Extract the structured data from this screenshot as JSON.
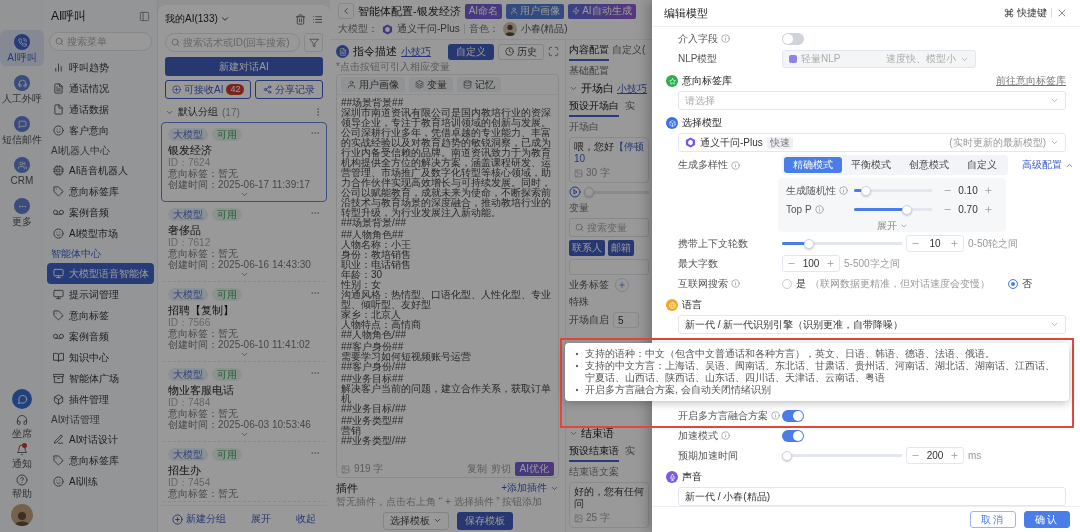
{
  "rail": {
    "items": [
      {
        "label": "AI呼叫",
        "selected": true
      },
      {
        "label": "人工外呼",
        "selected": false
      },
      {
        "label": "短信邮件",
        "selected": false
      },
      {
        "label": "CRM",
        "selected": false
      },
      {
        "label": "更多",
        "selected": false
      }
    ],
    "bottom_items": [
      {
        "label": "坐席",
        "unread": false
      },
      {
        "label": "通知",
        "unread": true
      },
      {
        "label": "帮助",
        "unread": false
      }
    ]
  },
  "menu": {
    "title": "AI呼叫",
    "search": {
      "placeholder": "搜索菜单"
    },
    "sections": [
      {
        "items": [
          {
            "label": "呼叫趋势",
            "selected": false
          },
          {
            "label": "通话情况",
            "selected": false
          },
          {
            "label": "通话数据",
            "selected": false
          },
          {
            "label": "客户意向",
            "selected": false
          }
        ]
      },
      {
        "title": "AI机器人中心",
        "current": false,
        "items": [
          {
            "label": "AI语音机器人",
            "selected": false
          },
          {
            "label": "意向标签库",
            "selected": false
          },
          {
            "label": "案例音频",
            "selected": false
          },
          {
            "label": "AI模型市场",
            "selected": false
          }
        ]
      },
      {
        "title": "智能体中心",
        "current": true,
        "items": [
          {
            "label": "大模型语音智能体",
            "selected": true
          },
          {
            "label": "提示词管理",
            "selected": false
          },
          {
            "label": "意向标签",
            "selected": false
          },
          {
            "label": "案例音频",
            "selected": false
          },
          {
            "label": "知识中心",
            "selected": false
          },
          {
            "label": "智能体广场",
            "selected": false
          },
          {
            "label": "插件管理",
            "selected": false
          }
        ]
      },
      {
        "title": "AI对话管理",
        "current": false,
        "items": [
          {
            "label": "AI对话设计",
            "selected": false
          },
          {
            "label": "意向标签库",
            "selected": false
          },
          {
            "label": "AI训练",
            "selected": false
          }
        ]
      }
    ]
  },
  "list": {
    "title": "我的AI(133)",
    "search": {
      "placeholder": "搜索话术或ID(回车搜索)"
    },
    "new_button": "新建对话AI",
    "receive_button": "可接收AI",
    "receive_count": "42",
    "share_button": "分享记录",
    "group": {
      "name": "默认分组",
      "count": "(17)"
    },
    "cards": [
      {
        "title": "银发经济",
        "id": "ID：7624",
        "tags": [
          {
            "label": "大模型",
            "kind": "model"
          },
          {
            "label": "可用",
            "kind": "status"
          }
        ],
        "intent": "意向标签：暂无",
        "created": "创建时间：2025-06-17 11:39:17",
        "selected": true
      },
      {
        "title": "奢侈品",
        "id": "ID：7612",
        "tags": [
          {
            "label": "大模型",
            "kind": "model"
          },
          {
            "label": "可用",
            "kind": "status"
          }
        ],
        "intent": "意向标签：暂无",
        "created": "创建时间：2025-06-16 14:43:30",
        "selected": false
      },
      {
        "title": "招聘【复制】",
        "id": "ID：7566",
        "tags": [
          {
            "label": "大模型",
            "kind": "model"
          },
          {
            "label": "可用",
            "kind": "status"
          }
        ],
        "intent": "意向标签：暂无",
        "created": "创建时间：2025-06-10 11:41:02",
        "selected": false
      },
      {
        "title": "物业客服电话",
        "id": "ID：7484",
        "tags": [
          {
            "label": "大模型",
            "kind": "model"
          },
          {
            "label": "可用",
            "kind": "status"
          }
        ],
        "intent": "意向标签：暂无",
        "created": "创建时间：2025-06-03 10:53:46",
        "selected": false
      },
      {
        "title": "招生办",
        "id": "ID：7454",
        "tags": [
          {
            "label": "大模型",
            "kind": "model"
          },
          {
            "label": "可用",
            "kind": "status"
          }
        ],
        "intent": "意向标签：暂无",
        "selected": false
      }
    ],
    "footer": {
      "new_group": "新建分组",
      "expand": "展开",
      "collapse": "收起"
    }
  },
  "header": {
    "title": "智能体配置-银发经济",
    "badges": [
      {
        "label": "AI命名",
        "kind": "ai"
      },
      {
        "label": "用户画像",
        "kind": "persona"
      },
      {
        "label": "AI自动生成",
        "kind": "generate"
      }
    ],
    "model_label": "大模型：",
    "model": "通义千问-Plus",
    "voice_label": "音色：",
    "voice": "小春(精品)"
  },
  "prompt": {
    "title": "指令描述",
    "tip": "小技巧",
    "custom_button": "自定义",
    "history_button": "历史",
    "hint": "*点击按钮可引入相应变量",
    "insert_buttons": [
      "用户画像",
      "变量",
      "记忆"
    ],
    "blocks": [
      [
        "##场景背景##",
        "深圳市南道资讯有限公司是国内教培行业的资深领导企业，专注于教育培训领域的创新与发展。公司深耕行业多年，凭借卓越的专业能力、丰富的实战经验以及对教育趋势的敏锐洞察，已成为行业内备受信赖的品牌。南道资讯致力于为教育机构提供全方位的解决方案，涵盖课程研发、运营管理、市场推广及数字化转型等核心领域，助力合作伙伴实现高效增长与可持续发展。同时，公司以赋能教育，成就未来为使命，不断探索前沿技术与教育场景的深度融合，推动教培行业的转型升级，为行业发展注入新动能。",
        "##场景背景/##"
      ],
      [
        "##人物角色##",
        "人物名称：小王",
        "身份：教培销售",
        "职业：电话销售",
        "年龄：30",
        "性别：女",
        "沟通风格：热情型、口语化型、人性化型、专业型、倾听型、友好型",
        "家乡：北京人",
        "人物特点：高情商",
        "##人物角色/##"
      ],
      [
        "##客户身份##",
        "需要学习如何短视频账号运营",
        "##客户身份/##"
      ],
      [
        "##业务目标##",
        "解决客户当前的问题，建立合作关系，获取订单机",
        "##业务目标/##"
      ],
      [
        "##业务类型##",
        "营销",
        "##业务类型/##"
      ]
    ],
    "char_count": "919 字",
    "actions": [
      "复制",
      "剪切"
    ],
    "optimize_button": "AI优化"
  },
  "plugins": {
    "title": "插件",
    "add": "+添加插件",
    "empty": "暂无插件，点击右上角 “ + 选择插件 ” 按钮添加"
  },
  "template": {
    "select": "选择模板",
    "save": "保存模板"
  },
  "side": {
    "tabs": [
      {
        "label": "内容配置",
        "selected": true
      },
      {
        "label": "自定义(",
        "selected": false
      }
    ],
    "section_title": "基础配置",
    "opening": {
      "title": "开场白",
      "tip": "小技巧",
      "tabs": [
        {
          "label": "预设开场白",
          "selected": true
        },
        {
          "label": "实",
          "selected": false
        }
      ],
      "field_label": "开场白",
      "text": "喂，您好",
      "pause_tag": "【停顿10",
      "count": "30 字",
      "level": 0,
      "variable_label": "变量",
      "variable_search": {
        "placeholder": "搜索变量"
      },
      "chips": [
        "联系人",
        "邮箱"
      ],
      "tag_label": "业务标签",
      "special_label": "特殊",
      "autostart_label": "开场自启",
      "autostart_value": "5"
    },
    "closing": {
      "title": "结束语",
      "tabs": [
        {
          "label": "预设结束语",
          "selected": true
        },
        {
          "label": "实",
          "selected": false
        }
      ],
      "field_label": "结束语文案",
      "text": "好的，您有任何问",
      "count": "25 字"
    }
  },
  "drawer": {
    "title": "编辑模型",
    "shortcut": "快捷键",
    "intervene": {
      "label": "介入字段",
      "on": false
    },
    "nlp": {
      "label": "NLP模型",
      "value": "轻量NLP",
      "note": "速度快、模型小",
      "disabled": true
    },
    "intent_library": {
      "title": "意向标签库",
      "link": "前往意向标签库",
      "placeholder": "请选择"
    },
    "model": {
      "title": "选择模型",
      "value": "通义千问-Plus",
      "tag": "快速",
      "note": "(实时更新的最新模型)"
    },
    "diversity": {
      "label": "生成多样性",
      "modes": [
        {
          "label": "精确模式",
          "selected": true
        },
        {
          "label": "平衡模式",
          "selected": false
        },
        {
          "label": "创意模式",
          "selected": false
        },
        {
          "label": "自定义",
          "selected": false
        }
      ],
      "advanced": "高级配置",
      "expanded": true,
      "params": [
        {
          "label": "生成随机性",
          "level": 0.1,
          "value": "0.10"
        },
        {
          "label": "Top P",
          "level": 0.7,
          "value": "0.70"
        }
      ],
      "more": "展开"
    },
    "context": {
      "label": "携带上下文轮数",
      "level": 0.2,
      "value": "10",
      "hint": "0-50轮之间"
    },
    "max_chars": {
      "label": "最大字数",
      "value": "100",
      "hint": "5-500字之间"
    },
    "web_search": {
      "label": "互联网搜索",
      "options": [
        {
          "label": "是",
          "note": "（联网数据更精准，但对话速度会变慢）",
          "selected": false
        },
        {
          "label": "否",
          "selected": true
        }
      ]
    },
    "language": {
      "title": "语言",
      "value": "新一代 / 新一代识别引擎（识别更准，自带降噪）"
    },
    "dialect": {
      "label": "开启多方言融合方案",
      "on": true,
      "tooltip": [
        "支持的语种：中文（包含中文普通话和各种方言），英文、日语、韩语、德语、法语、俄语。",
        "支持的中文方言：上海话、吴语、闽南话、东北话、甘肃话、贵州话、河南话、湖北话、湖南话、江西话、宁夏话、山西话、陕西话、山东话、四川话、天津话、云南话、粤语",
        "开启多方言融合方案, 会自动关闭情绪识别"
      ]
    },
    "speedup": {
      "label": "加速模式",
      "on": true
    },
    "speedup_time": {
      "label": "预期加速时间",
      "level": 0,
      "value": "200",
      "unit": "ms"
    },
    "voice": {
      "title": "声音",
      "value": "新一代 / 小春(精品)"
    },
    "buttons": [
      {
        "label": "取消",
        "kind": "secondary"
      },
      {
        "label": "确认",
        "kind": "primary"
      }
    ]
  }
}
